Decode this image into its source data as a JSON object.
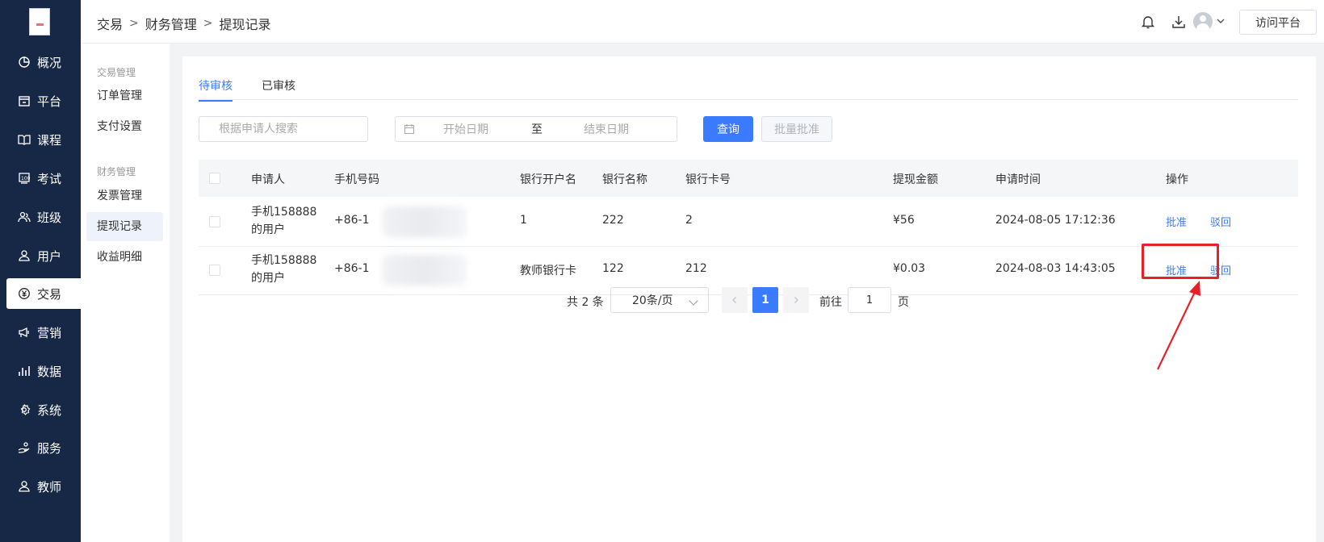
{
  "nav": {
    "items": [
      {
        "label": "概况",
        "icon": "pie-chart-icon"
      },
      {
        "label": "平台",
        "icon": "store-icon"
      },
      {
        "label": "课程",
        "icon": "book-icon"
      },
      {
        "label": "考试",
        "icon": "exam-icon"
      },
      {
        "label": "班级",
        "icon": "group-icon"
      },
      {
        "label": "用户",
        "icon": "user-icon"
      },
      {
        "label": "交易",
        "icon": "yuan-icon"
      },
      {
        "label": "营销",
        "icon": "megaphone-icon"
      },
      {
        "label": "数据",
        "icon": "bar-chart-icon"
      },
      {
        "label": "系统",
        "icon": "gear-icon"
      },
      {
        "label": "服务",
        "icon": "hand-service-icon"
      },
      {
        "label": "教师",
        "icon": "teacher-icon"
      }
    ],
    "active": "交易"
  },
  "submenu": {
    "group1": "交易管理",
    "group1_items": [
      "订单管理",
      "支付设置"
    ],
    "group2": "财务管理",
    "group2_items": [
      "发票管理",
      "提现记录",
      "收益明细"
    ],
    "active": "提现记录"
  },
  "header": {
    "breadcrumb": [
      "交易",
      "财务管理",
      "提现记录"
    ],
    "visit_label": "访问平台"
  },
  "tabs": [
    "待审核",
    "已审核"
  ],
  "filters": {
    "search_placeholder": "根据申请人搜索",
    "start_placeholder": "开始日期",
    "to_label": "至",
    "end_placeholder": "结束日期",
    "query_label": "查询",
    "batch_label": "批量批准"
  },
  "table": {
    "columns": [
      "申请人",
      "手机号码",
      "银行开户名",
      "银行名称",
      "银行卡号",
      "提现金额",
      "申请时间",
      "操作"
    ],
    "rows": [
      {
        "applicant_l1": "手机158888",
        "applicant_l2": "的用户",
        "phone": "+86-1",
        "account_name": "1",
        "bank": "222",
        "card": "2",
        "amount": "¥56",
        "time": "2024-08-05 17:12:36",
        "approve": "批准",
        "reject": "驳回"
      },
      {
        "applicant_l1": "手机158888",
        "applicant_l2": "的用户",
        "phone": "+86-1",
        "account_name": "教师银行卡",
        "bank": "122",
        "card": "212",
        "amount": "¥0.03",
        "time": "2024-08-03 14:43:05",
        "approve": "批准",
        "reject": "驳回"
      }
    ]
  },
  "pagination": {
    "total": "共 2 条",
    "page_size": "20条/页",
    "current_page": "1",
    "goto_label": "前往",
    "goto_value": "1",
    "goto_suffix": "页"
  },
  "colors": {
    "rail": "#172746",
    "accent": "#3b7bff",
    "highlight": "#e8202a"
  }
}
